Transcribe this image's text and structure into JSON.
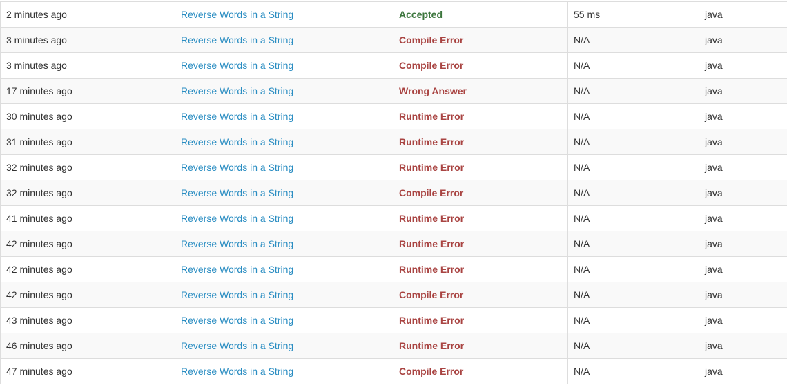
{
  "colors": {
    "link": "#2a8dc2",
    "accepted": "#3c763d",
    "error": "#a94442",
    "row_stripe": "#f9f9f9",
    "border": "#dddddd"
  },
  "submissions": [
    {
      "time": "2 minutes ago",
      "problem": "Reverse Words in a String",
      "status": "Accepted",
      "runtime": "55 ms",
      "language": "java"
    },
    {
      "time": "3 minutes ago",
      "problem": "Reverse Words in a String",
      "status": "Compile Error",
      "runtime": "N/A",
      "language": "java"
    },
    {
      "time": "3 minutes ago",
      "problem": "Reverse Words in a String",
      "status": "Compile Error",
      "runtime": "N/A",
      "language": "java"
    },
    {
      "time": "17 minutes ago",
      "problem": "Reverse Words in a String",
      "status": "Wrong Answer",
      "runtime": "N/A",
      "language": "java"
    },
    {
      "time": "30 minutes ago",
      "problem": "Reverse Words in a String",
      "status": "Runtime Error",
      "runtime": "N/A",
      "language": "java"
    },
    {
      "time": "31 minutes ago",
      "problem": "Reverse Words in a String",
      "status": "Runtime Error",
      "runtime": "N/A",
      "language": "java"
    },
    {
      "time": "32 minutes ago",
      "problem": "Reverse Words in a String",
      "status": "Runtime Error",
      "runtime": "N/A",
      "language": "java"
    },
    {
      "time": "32 minutes ago",
      "problem": "Reverse Words in a String",
      "status": "Compile Error",
      "runtime": "N/A",
      "language": "java"
    },
    {
      "time": "41 minutes ago",
      "problem": "Reverse Words in a String",
      "status": "Runtime Error",
      "runtime": "N/A",
      "language": "java"
    },
    {
      "time": "42 minutes ago",
      "problem": "Reverse Words in a String",
      "status": "Runtime Error",
      "runtime": "N/A",
      "language": "java"
    },
    {
      "time": "42 minutes ago",
      "problem": "Reverse Words in a String",
      "status": "Runtime Error",
      "runtime": "N/A",
      "language": "java"
    },
    {
      "time": "42 minutes ago",
      "problem": "Reverse Words in a String",
      "status": "Compile Error",
      "runtime": "N/A",
      "language": "java"
    },
    {
      "time": "43 minutes ago",
      "problem": "Reverse Words in a String",
      "status": "Runtime Error",
      "runtime": "N/A",
      "language": "java"
    },
    {
      "time": "46 minutes ago",
      "problem": "Reverse Words in a String",
      "status": "Runtime Error",
      "runtime": "N/A",
      "language": "java"
    },
    {
      "time": "47 minutes ago",
      "problem": "Reverse Words in a String",
      "status": "Compile Error",
      "runtime": "N/A",
      "language": "java"
    }
  ]
}
